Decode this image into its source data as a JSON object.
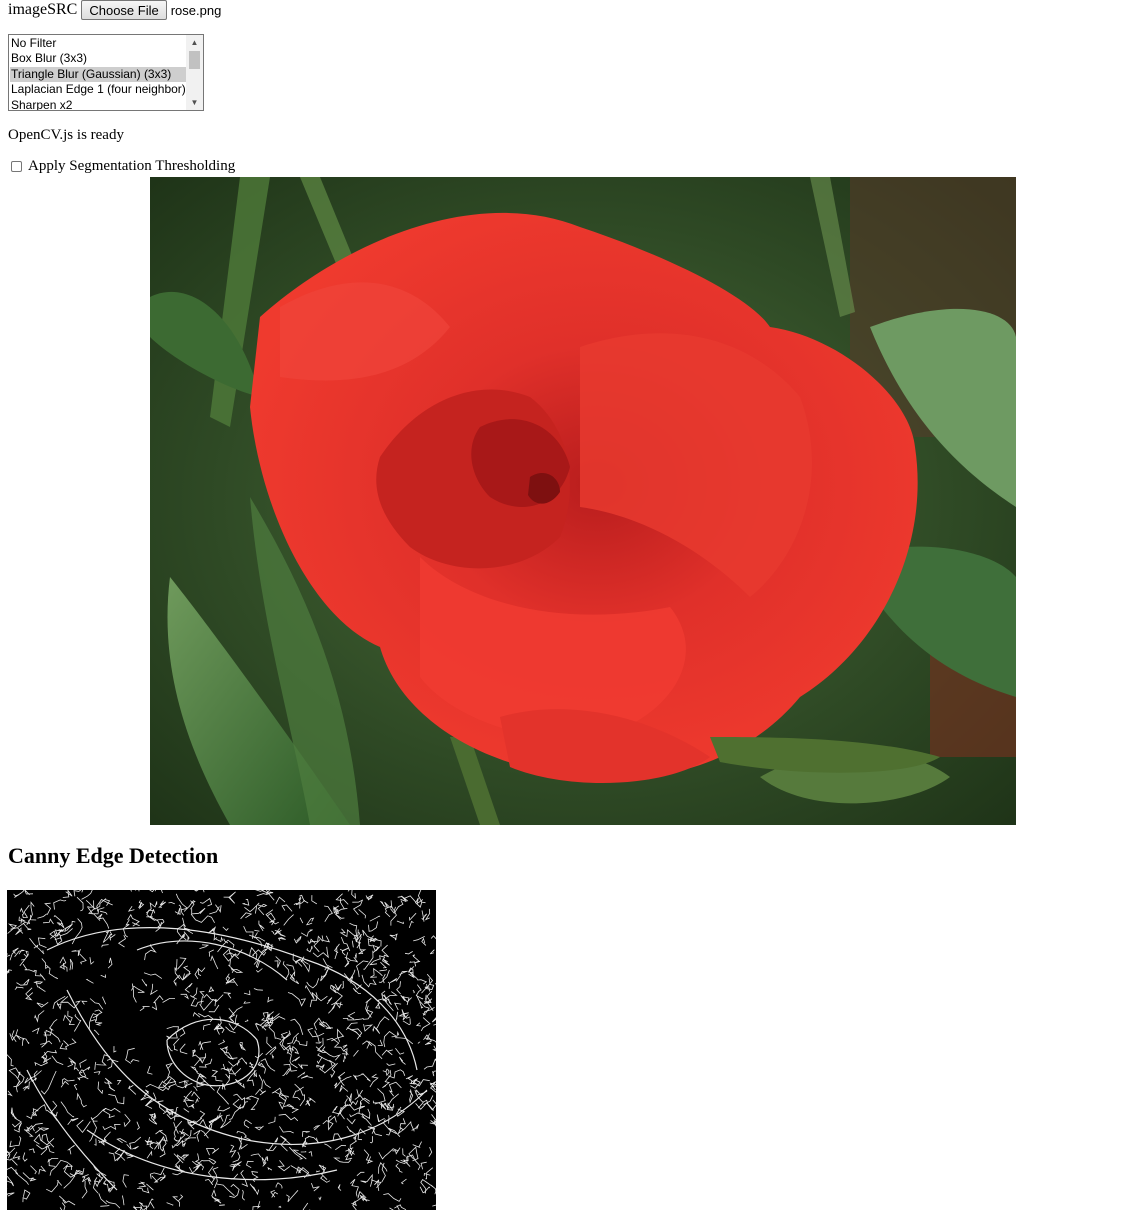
{
  "file_input": {
    "label": "imageSRC",
    "button_label": "Choose File",
    "file_name": "rose.png"
  },
  "filter_list": {
    "options": [
      "No Filter",
      "Box Blur (3x3)",
      "Triangle Blur (Gaussian) (3x3)",
      "Laplacian Edge 1 (four neighbor)",
      "Sharpen x2"
    ],
    "selected": "Triangle Blur (Gaussian) (3x3)"
  },
  "status_text": "OpenCV.js is ready",
  "segmentation": {
    "label": "Apply Segmentation Thresholding",
    "checked": false
  },
  "edge_section": {
    "heading": "Canny Edge Detection"
  },
  "icons": {
    "scroll_up": "chevron-up-icon",
    "scroll_down": "chevron-down-icon"
  },
  "colors": {
    "rose": "#e6302a",
    "leaf": "#3d6b34",
    "edge_bg": "#000000"
  }
}
